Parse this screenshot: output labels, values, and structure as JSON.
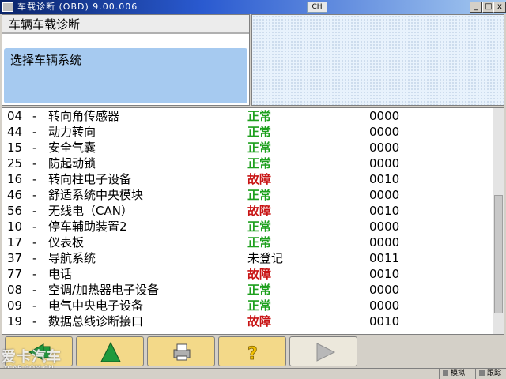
{
  "window": {
    "title": "车载诊断 (OBD) 9.00.006",
    "language": "CH",
    "minimize_label": "_",
    "maximize_label": "□",
    "close_label": "x"
  },
  "header": {
    "breadcrumb": "车辆车载诊断",
    "subtitle": "选择车辆系统"
  },
  "systems": [
    {
      "code": "04",
      "name": "转向角传感器",
      "status": "正常",
      "fault_code": "0000",
      "status_color": "#1ea01e"
    },
    {
      "code": "44",
      "name": "动力转向",
      "status": "正常",
      "fault_code": "0000",
      "status_color": "#1ea01e"
    },
    {
      "code": "15",
      "name": "安全气囊",
      "status": "正常",
      "fault_code": "0000",
      "status_color": "#1ea01e"
    },
    {
      "code": "25",
      "name": "防起动锁",
      "status": "正常",
      "fault_code": "0000",
      "status_color": "#1ea01e"
    },
    {
      "code": "16",
      "name": "转向柱电子设备",
      "status": "故障",
      "fault_code": "0010",
      "status_color": "#c81414"
    },
    {
      "code": "46",
      "name": "舒适系统中央模块",
      "status": "正常",
      "fault_code": "0000",
      "status_color": "#1ea01e"
    },
    {
      "code": "56",
      "name": "无线电（CAN）",
      "status": "故障",
      "fault_code": "0010",
      "status_color": "#c81414"
    },
    {
      "code": "10",
      "name": "停车辅助装置2",
      "status": "正常",
      "fault_code": "0000",
      "status_color": "#1ea01e"
    },
    {
      "code": "17",
      "name": "仪表板",
      "status": "正常",
      "fault_code": "0000",
      "status_color": "#1ea01e"
    },
    {
      "code": "37",
      "name": "导航系统",
      "status": "未登记",
      "fault_code": "0011",
      "status_color": "#000000"
    },
    {
      "code": "77",
      "name": "电话",
      "status": "故障",
      "fault_code": "0010",
      "status_color": "#c81414"
    },
    {
      "code": "08",
      "name": "空调/加热器电子设备",
      "status": "正常",
      "fault_code": "0000",
      "status_color": "#1ea01e"
    },
    {
      "code": "09",
      "name": "电气中央电子设备",
      "status": "正常",
      "fault_code": "0000",
      "status_color": "#1ea01e"
    },
    {
      "code": "19",
      "name": "数据总线诊断接口",
      "status": "故障",
      "fault_code": "0010",
      "status_color": "#c81414"
    }
  ],
  "separator": "-",
  "toolbar": {
    "buttons": [
      {
        "id": "back",
        "icon": "back-arrow-icon"
      },
      {
        "id": "up",
        "icon": "up-triangle-icon"
      },
      {
        "id": "print",
        "icon": "printer-icon"
      },
      {
        "id": "help",
        "icon": "help-icon"
      },
      {
        "id": "forward",
        "icon": "play-right-icon"
      }
    ]
  },
  "statusbar": {
    "simulate": "模拟",
    "trace": "跟踪"
  },
  "watermark": {
    "brand": "爱卡汽车",
    "site": "XCAR.COM.CN"
  }
}
